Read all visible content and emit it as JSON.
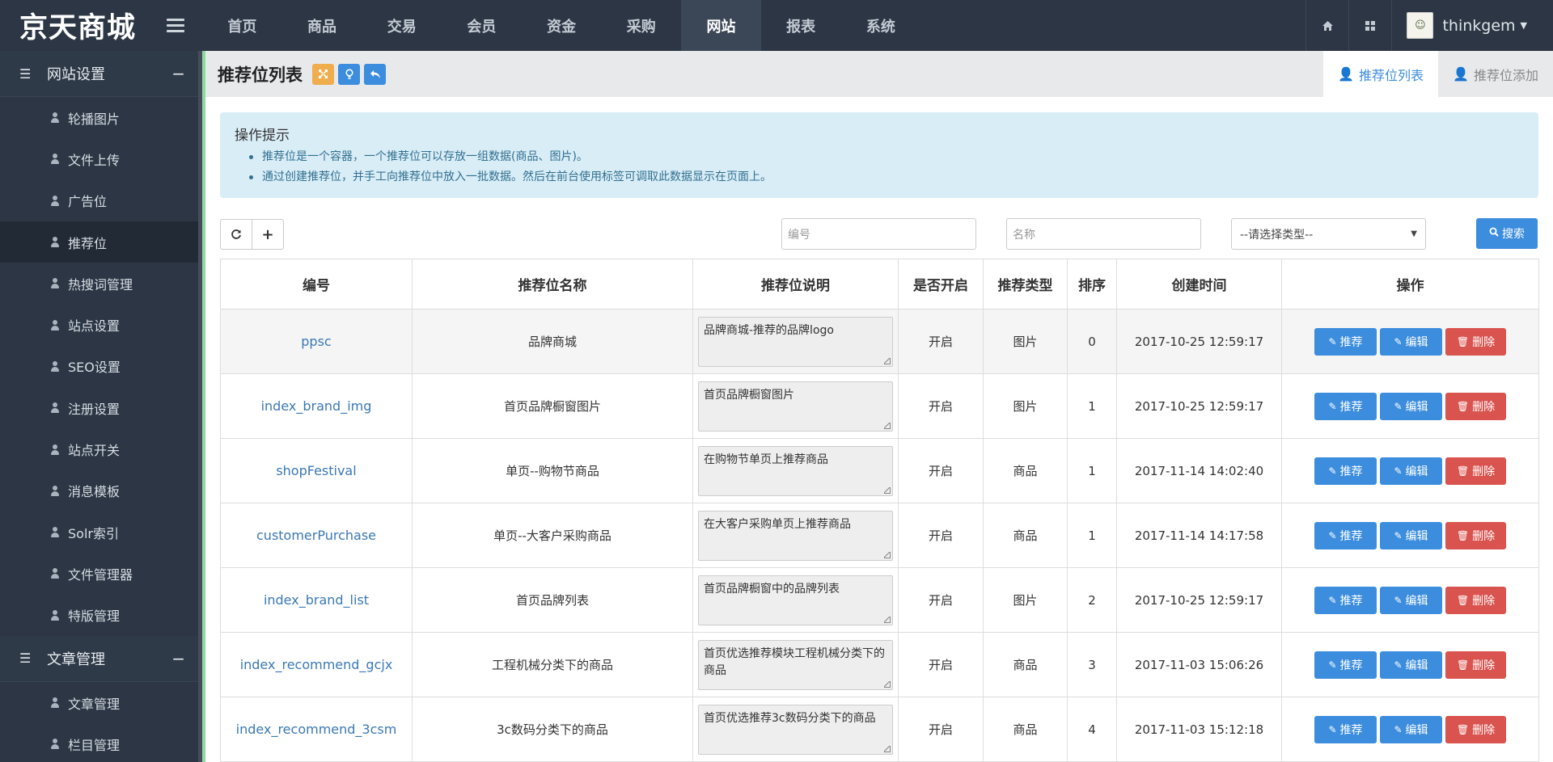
{
  "brand": "京天商城",
  "nav": [
    "首页",
    "商品",
    "交易",
    "会员",
    "资金",
    "采购",
    "网站",
    "报表",
    "系统"
  ],
  "user": {
    "name": "thinkgem"
  },
  "sidebar": {
    "groups": [
      {
        "label": "网站设置",
        "items": [
          "轮播图片",
          "文件上传",
          "广告位",
          "推荐位",
          "热搜词管理",
          "站点设置",
          "SEO设置",
          "注册设置",
          "站点开关",
          "消息模板",
          "Solr索引",
          "文件管理器",
          "特版管理"
        ]
      },
      {
        "label": "文章管理",
        "items": [
          "文章管理",
          "栏目管理"
        ]
      }
    ]
  },
  "page": {
    "title": "推荐位列表",
    "tabs": [
      "推荐位列表",
      "推荐位添加"
    ]
  },
  "tips": {
    "title": "操作提示",
    "items": [
      "推荐位是一个容器，一个推荐位可以存放一组数据(商品、图片)。",
      "通过创建推荐位，并手工向推荐位中放入一批数据。然后在前台使用标签可调取此数据显示在页面上。"
    ]
  },
  "filters": {
    "code_placeholder": "编号",
    "name_placeholder": "名称",
    "type_select": "--请选择类型--",
    "search_label": "搜索"
  },
  "table": {
    "headers": [
      "编号",
      "推荐位名称",
      "推荐位说明",
      "是否开启",
      "推荐类型",
      "排序",
      "创建时间",
      "操作"
    ],
    "actions": {
      "recommend": "推荐",
      "edit": "编辑",
      "delete": "删除"
    },
    "rows": [
      {
        "code": "ppsc",
        "name": "品牌商城",
        "desc": "品牌商城-推荐的品牌logo",
        "enabled": "开启",
        "type": "图片",
        "sort": "0",
        "created": "2017-10-25 12:59:17"
      },
      {
        "code": "index_brand_img",
        "name": "首页品牌橱窗图片",
        "desc": "首页品牌橱窗图片",
        "enabled": "开启",
        "type": "图片",
        "sort": "1",
        "created": "2017-10-25 12:59:17"
      },
      {
        "code": "shopFestival",
        "name": "单页--购物节商品",
        "desc": "在购物节单页上推荐商品",
        "enabled": "开启",
        "type": "商品",
        "sort": "1",
        "created": "2017-11-14 14:02:40"
      },
      {
        "code": "customerPurchase",
        "name": "单页--大客户采购商品",
        "desc": "在大客户采购单页上推荐商品",
        "enabled": "开启",
        "type": "商品",
        "sort": "1",
        "created": "2017-11-14 14:17:58"
      },
      {
        "code": "index_brand_list",
        "name": "首页品牌列表",
        "desc": "首页品牌橱窗中的品牌列表",
        "enabled": "开启",
        "type": "图片",
        "sort": "2",
        "created": "2017-10-25 12:59:17"
      },
      {
        "code": "index_recommend_gcjx",
        "name": "工程机械分类下的商品",
        "desc": "首页优选推荐模块工程机械分类下的商品",
        "enabled": "开启",
        "type": "商品",
        "sort": "3",
        "created": "2017-11-03 15:06:26"
      },
      {
        "code": "index_recommend_3csm",
        "name": "3c数码分类下的商品",
        "desc": "首页优选推荐3c数码分类下的商品",
        "enabled": "开启",
        "type": "商品",
        "sort": "4",
        "created": "2017-11-03 15:12:18"
      }
    ]
  },
  "colors": {
    "primary": "#3c8dde",
    "danger": "#d9534f",
    "warning": "#f0ad4e",
    "topbar": "#2c3644",
    "tips_bg": "#d9edf7"
  }
}
